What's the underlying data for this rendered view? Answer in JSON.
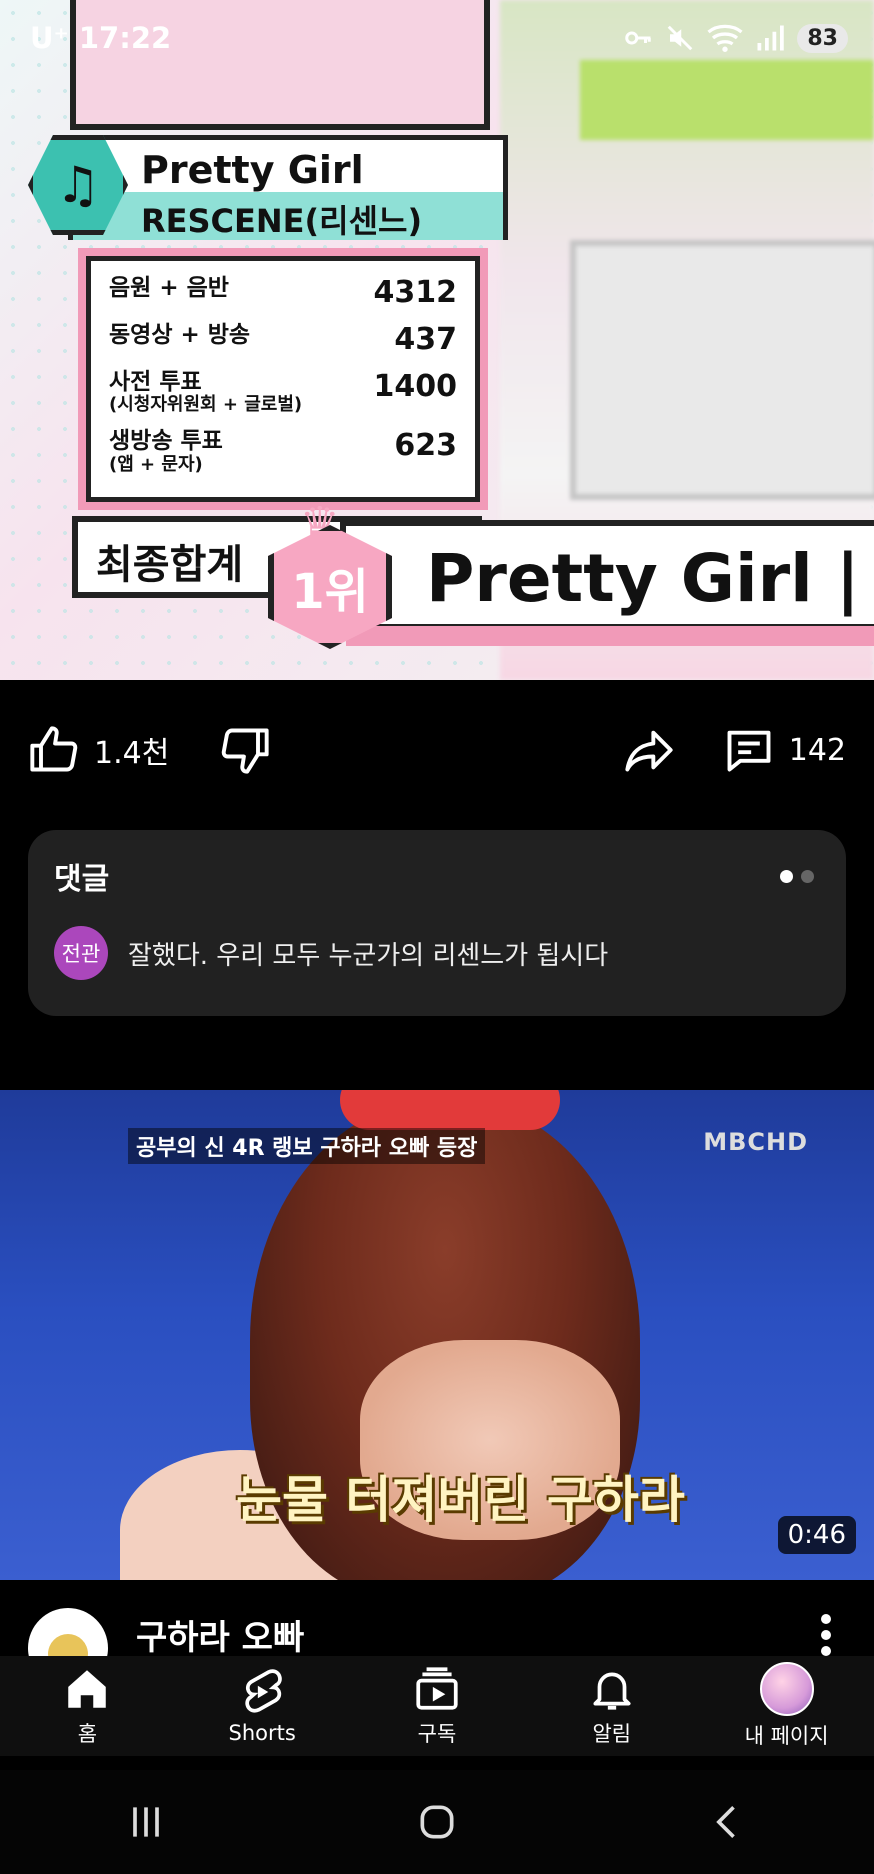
{
  "status_bar": {
    "carrier": "U⁺",
    "time": "17:22",
    "battery": "83"
  },
  "video1": {
    "song_title": "Pretty Girl",
    "artist": "RESCENE(리센느)",
    "scores": [
      {
        "label": "음원 + 음반",
        "sub": "",
        "value": "4312"
      },
      {
        "label": "동영상 + 방송",
        "sub": "",
        "value": "437"
      },
      {
        "label": "사전 투표",
        "sub": "(시청자위원회 + 글로벌)",
        "value": "1400"
      },
      {
        "label": "생방송 투표",
        "sub": "(앱 + 문자)",
        "value": "623"
      }
    ],
    "final_label": "최종합계",
    "rank": "1위",
    "banner_text": "Pretty Girl | R"
  },
  "actions": {
    "like_count": "1.4천",
    "comment_count": "142",
    "icons": [
      "thumbs-up-icon",
      "thumbs-down-icon",
      "share-icon",
      "comment-icon"
    ]
  },
  "comments": {
    "title": "댓글",
    "avatar_label": "전관",
    "avatar_color": "#ab47bc",
    "text": "잘했다. 우리 모두 누군가의 리센느가 됩시다"
  },
  "video2": {
    "show_logo": "공부의 신 4R 랭보 구하라 오빠 등장",
    "channel_logo": "MBCHD",
    "caption": "눈물 터져버린 구하라",
    "duration": "0:46",
    "channel_name": "구하라 오빠"
  },
  "bottom_nav": {
    "items": [
      {
        "label": "홈",
        "icon": "home-icon"
      },
      {
        "label": "Shorts",
        "icon": "shorts-icon"
      },
      {
        "label": "구독",
        "icon": "subscriptions-icon"
      },
      {
        "label": "알림",
        "icon": "bell-icon"
      },
      {
        "label": "내 페이지",
        "icon": "avatar"
      }
    ]
  }
}
